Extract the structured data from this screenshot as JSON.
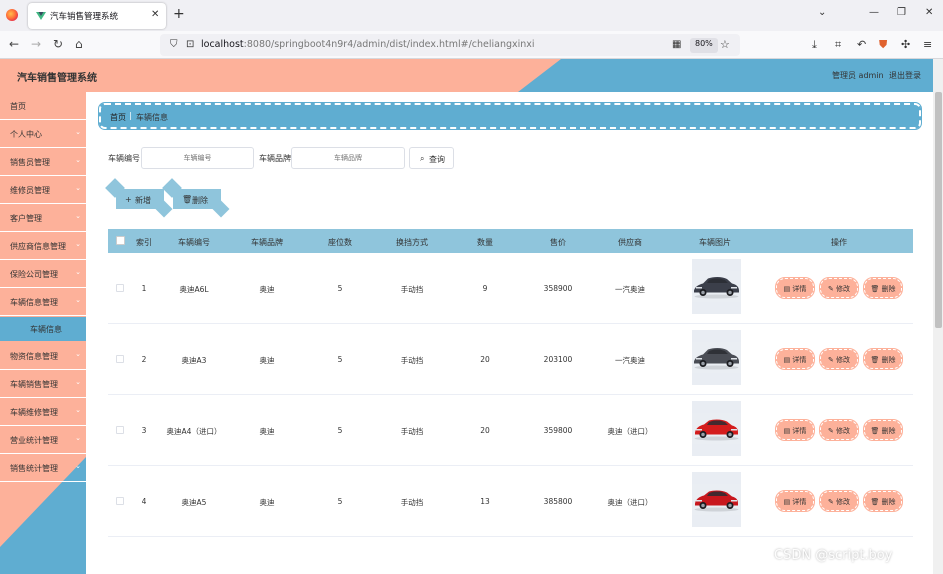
{
  "browser": {
    "tab_title": "汽车销售管理系统",
    "url_host": "localhost",
    "url_rest": ":8080/springboot4n9r4/admin/dist/index.html#/cheliangxinxi",
    "zoom": "80%"
  },
  "header": {
    "title": "汽车销售管理系统",
    "user_label": "管理员 admin",
    "logout": "退出登录"
  },
  "sidebar": {
    "items": [
      {
        "label": "首页",
        "arrow": false
      },
      {
        "label": "个人中心",
        "arrow": true
      },
      {
        "label": "销售员管理",
        "arrow": true
      },
      {
        "label": "维修员管理",
        "arrow": true
      },
      {
        "label": "客户管理",
        "arrow": true
      },
      {
        "label": "供应商信息管理",
        "arrow": true
      },
      {
        "label": "保险公司管理",
        "arrow": true
      },
      {
        "label": "车辆信息管理",
        "arrow": true
      },
      {
        "label": "物资信息管理",
        "arrow": true
      },
      {
        "label": "车辆销售管理",
        "arrow": true
      },
      {
        "label": "车辆维修管理",
        "arrow": true
      },
      {
        "label": "营业统计管理",
        "arrow": true
      },
      {
        "label": "销售统计管理",
        "arrow": true
      }
    ],
    "active_sub": "车辆信息"
  },
  "breadcrumb": {
    "home": "首页",
    "current": "车辆信息"
  },
  "search": {
    "code_label": "车辆编号",
    "code_placeholder": "车辆编号",
    "brand_label": "车辆品牌",
    "brand_placeholder": "车辆品牌",
    "query_label": "查询"
  },
  "actions": {
    "add_label": "新增",
    "delete_label": "删除"
  },
  "table": {
    "columns": [
      "索引",
      "车辆编号",
      "车辆品牌",
      "座位数",
      "换挡方式",
      "数量",
      "售价",
      "供应商",
      "车辆图片",
      "操作"
    ],
    "row_actions": {
      "detail": "详情",
      "edit": "修改",
      "delete": "删除"
    },
    "rows": [
      {
        "index": "1",
        "code": "奥迪A6L",
        "brand": "奥迪",
        "seats": "5",
        "gearbox": "手动挡",
        "qty": "9",
        "price": "358900",
        "supplier": "一汽奥迪",
        "car_color": "#3b3f4a"
      },
      {
        "index": "2",
        "code": "奥迪A3",
        "brand": "奥迪",
        "seats": "5",
        "gearbox": "手动挡",
        "qty": "20",
        "price": "203100",
        "supplier": "一汽奥迪",
        "car_color": "#4a4d55"
      },
      {
        "index": "3",
        "code": "奥迪A4（进口）",
        "brand": "奥迪",
        "seats": "5",
        "gearbox": "手动挡",
        "qty": "20",
        "price": "359800",
        "supplier": "奥迪（进口）",
        "car_color": "#d41c1c"
      },
      {
        "index": "4",
        "code": "奥迪A5",
        "brand": "奥迪",
        "seats": "5",
        "gearbox": "手动挡",
        "qty": "13",
        "price": "385800",
        "supplier": "奥迪（进口）",
        "car_color": "#c8171d"
      }
    ]
  },
  "watermark": "CSDN @script.boy"
}
